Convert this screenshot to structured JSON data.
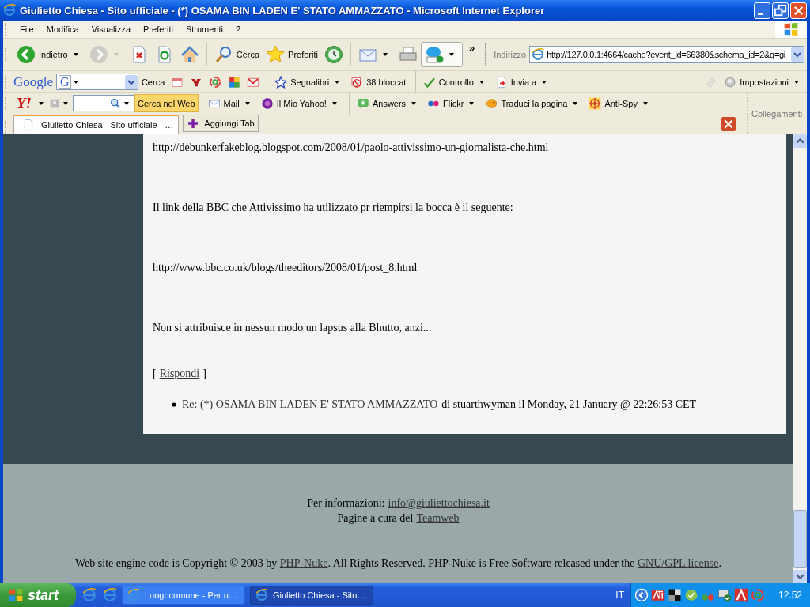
{
  "window": {
    "title": "Giulietto Chiesa - Sito ufficiale - (*) OSAMA BIN LADEN E' STATO AMMAZZATO - Microsoft Internet Explorer"
  },
  "menu": [
    "File",
    "Modifica",
    "Visualizza",
    "Preferiti",
    "Strumenti",
    "?"
  ],
  "toolbar": [
    {
      "label": "Indietro",
      "menu": true,
      "disabled": false,
      "highlighted": false
    },
    {
      "menu": true,
      "disabled": true,
      "highlighted": false
    },
    {
      "menu": false,
      "disabled": false,
      "highlighted": false
    },
    {
      "menu": false,
      "disabled": false,
      "highlighted": false
    },
    {
      "menu": false,
      "disabled": false,
      "highlighted": false
    },
    {
      "label": "Cerca",
      "menu": false,
      "disabled": false,
      "highlighted": false
    },
    {
      "label": "Preferiti",
      "menu": false,
      "disabled": false,
      "highlighted": false
    },
    {
      "menu": false,
      "disabled": false,
      "highlighted": false
    },
    {
      "menu": true,
      "disabled": false,
      "highlighted": false
    },
    {
      "menu": false,
      "disabled": false,
      "highlighted": false
    },
    {
      "menu": true,
      "disabled": false,
      "highlighted": true
    }
  ],
  "chevron": "»",
  "address": {
    "label": "Indirizzo",
    "value": "http://127.0.0.1:4664/cache?event_id=66380&schema_id=2&q=gi"
  },
  "google": {
    "logo": "Google",
    "field_logo": "G",
    "search": "Cerca",
    "items": [
      {
        "label": "Segnalibri",
        "menu": true
      },
      {
        "label": "38 bloccati",
        "menu": false
      },
      {
        "label": "Controllo",
        "menu": true
      },
      {
        "label": "Invia a",
        "menu": true
      },
      {
        "label": "Impostazioni",
        "menu": true
      }
    ]
  },
  "yahoo": {
    "logo": "Y!",
    "button": "Cerca nel Web",
    "items": [
      {
        "label": "Mail",
        "menu": true
      },
      {
        "label": "Il Mio Yahoo!",
        "menu": true
      },
      {
        "label": "Answers",
        "menu": true
      },
      {
        "label": "Flickr",
        "menu": true
      },
      {
        "label": "Traduci la pagina",
        "menu": true
      },
      {
        "label": "Anti-Spy",
        "menu": true
      }
    ]
  },
  "links_label": "Collegamenti",
  "tabs": [
    {
      "label": "Giulietto Chiesa - Sito ufficiale - …",
      "selected": true
    }
  ],
  "add_tab": "Aggiungi Tab",
  "content": {
    "paragraphs": [
      "http://debunkerfakeblog.blogspot.com/2008/01/paolo-attivissimo-un-giornalista-che.html",
      "Il link della BBC che Attivissimo ha utilizzato pr riempirsi la bocca è il seguente:",
      "http://www.bbc.co.uk/blogs/theeditors/2008/01/post_8.html",
      "Non si attribuisce in nessun modo un lapsus alla Bhutto, anzi..."
    ],
    "reply": {
      "open": "[",
      "link": "Rispondi",
      "close": "]"
    },
    "comments": [
      {
        "link": "Re: (*) OSAMA BIN LADEN E' STATO AMMAZZATO",
        "meta": "di stuarthwyman il Monday, 21 January @ 22:26:53 CET"
      }
    ]
  },
  "footer": {
    "info_label": "Per informazioni:",
    "email": "info@giuliettochiesa.it",
    "pages_label": "Pagine a cura del",
    "team": "Teamweb",
    "copyright": [
      {
        "kind": "text",
        "text": "Web site engine code is Copyright © 2003 by "
      },
      {
        "kind": "link",
        "text": "PHP-Nuke"
      },
      {
        "kind": "text",
        "text": ". All Rights Reserved. PHP-Nuke is Free Software released under the "
      },
      {
        "kind": "link",
        "text": "GNU/GPL license"
      },
      {
        "kind": "text",
        "text": "."
      }
    ]
  },
  "taskbar": {
    "start": "start",
    "tasks": [
      {
        "label": "Luogocomune - Per u…",
        "selected": false
      },
      {
        "label": "Giulietto Chiesa - Sito…",
        "selected": true
      }
    ],
    "language": "IT",
    "clock": "12.52"
  }
}
